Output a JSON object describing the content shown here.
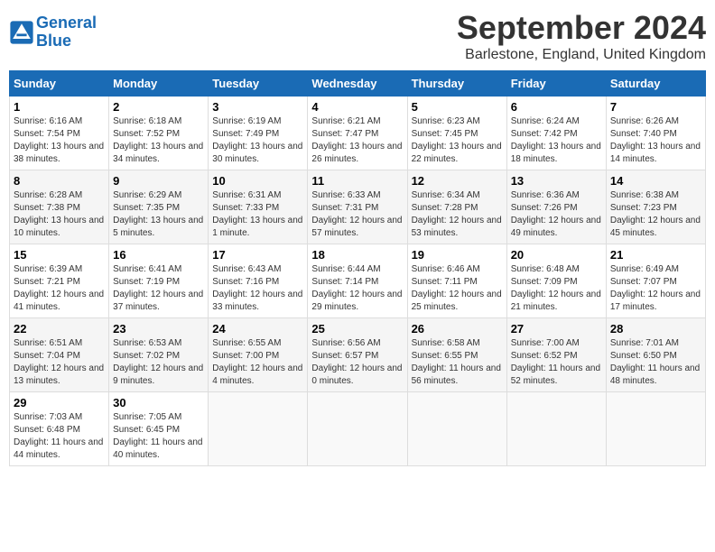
{
  "header": {
    "logo_line1": "General",
    "logo_line2": "Blue",
    "month_title": "September 2024",
    "location": "Barlestone, England, United Kingdom"
  },
  "weekdays": [
    "Sunday",
    "Monday",
    "Tuesday",
    "Wednesday",
    "Thursday",
    "Friday",
    "Saturday"
  ],
  "weeks": [
    [
      {
        "day": "1",
        "sunrise": "6:16 AM",
        "sunset": "7:54 PM",
        "daylight": "13 hours and 38 minutes."
      },
      {
        "day": "2",
        "sunrise": "6:18 AM",
        "sunset": "7:52 PM",
        "daylight": "13 hours and 34 minutes."
      },
      {
        "day": "3",
        "sunrise": "6:19 AM",
        "sunset": "7:49 PM",
        "daylight": "13 hours and 30 minutes."
      },
      {
        "day": "4",
        "sunrise": "6:21 AM",
        "sunset": "7:47 PM",
        "daylight": "13 hours and 26 minutes."
      },
      {
        "day": "5",
        "sunrise": "6:23 AM",
        "sunset": "7:45 PM",
        "daylight": "13 hours and 22 minutes."
      },
      {
        "day": "6",
        "sunrise": "6:24 AM",
        "sunset": "7:42 PM",
        "daylight": "13 hours and 18 minutes."
      },
      {
        "day": "7",
        "sunrise": "6:26 AM",
        "sunset": "7:40 PM",
        "daylight": "13 hours and 14 minutes."
      }
    ],
    [
      {
        "day": "8",
        "sunrise": "6:28 AM",
        "sunset": "7:38 PM",
        "daylight": "13 hours and 10 minutes."
      },
      {
        "day": "9",
        "sunrise": "6:29 AM",
        "sunset": "7:35 PM",
        "daylight": "13 hours and 5 minutes."
      },
      {
        "day": "10",
        "sunrise": "6:31 AM",
        "sunset": "7:33 PM",
        "daylight": "13 hours and 1 minute."
      },
      {
        "day": "11",
        "sunrise": "6:33 AM",
        "sunset": "7:31 PM",
        "daylight": "12 hours and 57 minutes."
      },
      {
        "day": "12",
        "sunrise": "6:34 AM",
        "sunset": "7:28 PM",
        "daylight": "12 hours and 53 minutes."
      },
      {
        "day": "13",
        "sunrise": "6:36 AM",
        "sunset": "7:26 PM",
        "daylight": "12 hours and 49 minutes."
      },
      {
        "day": "14",
        "sunrise": "6:38 AM",
        "sunset": "7:23 PM",
        "daylight": "12 hours and 45 minutes."
      }
    ],
    [
      {
        "day": "15",
        "sunrise": "6:39 AM",
        "sunset": "7:21 PM",
        "daylight": "12 hours and 41 minutes."
      },
      {
        "day": "16",
        "sunrise": "6:41 AM",
        "sunset": "7:19 PM",
        "daylight": "12 hours and 37 minutes."
      },
      {
        "day": "17",
        "sunrise": "6:43 AM",
        "sunset": "7:16 PM",
        "daylight": "12 hours and 33 minutes."
      },
      {
        "day": "18",
        "sunrise": "6:44 AM",
        "sunset": "7:14 PM",
        "daylight": "12 hours and 29 minutes."
      },
      {
        "day": "19",
        "sunrise": "6:46 AM",
        "sunset": "7:11 PM",
        "daylight": "12 hours and 25 minutes."
      },
      {
        "day": "20",
        "sunrise": "6:48 AM",
        "sunset": "7:09 PM",
        "daylight": "12 hours and 21 minutes."
      },
      {
        "day": "21",
        "sunrise": "6:49 AM",
        "sunset": "7:07 PM",
        "daylight": "12 hours and 17 minutes."
      }
    ],
    [
      {
        "day": "22",
        "sunrise": "6:51 AM",
        "sunset": "7:04 PM",
        "daylight": "12 hours and 13 minutes."
      },
      {
        "day": "23",
        "sunrise": "6:53 AM",
        "sunset": "7:02 PM",
        "daylight": "12 hours and 9 minutes."
      },
      {
        "day": "24",
        "sunrise": "6:55 AM",
        "sunset": "7:00 PM",
        "daylight": "12 hours and 4 minutes."
      },
      {
        "day": "25",
        "sunrise": "6:56 AM",
        "sunset": "6:57 PM",
        "daylight": "12 hours and 0 minutes."
      },
      {
        "day": "26",
        "sunrise": "6:58 AM",
        "sunset": "6:55 PM",
        "daylight": "11 hours and 56 minutes."
      },
      {
        "day": "27",
        "sunrise": "7:00 AM",
        "sunset": "6:52 PM",
        "daylight": "11 hours and 52 minutes."
      },
      {
        "day": "28",
        "sunrise": "7:01 AM",
        "sunset": "6:50 PM",
        "daylight": "11 hours and 48 minutes."
      }
    ],
    [
      {
        "day": "29",
        "sunrise": "7:03 AM",
        "sunset": "6:48 PM",
        "daylight": "11 hours and 44 minutes."
      },
      {
        "day": "30",
        "sunrise": "7:05 AM",
        "sunset": "6:45 PM",
        "daylight": "11 hours and 40 minutes."
      },
      null,
      null,
      null,
      null,
      null
    ]
  ]
}
